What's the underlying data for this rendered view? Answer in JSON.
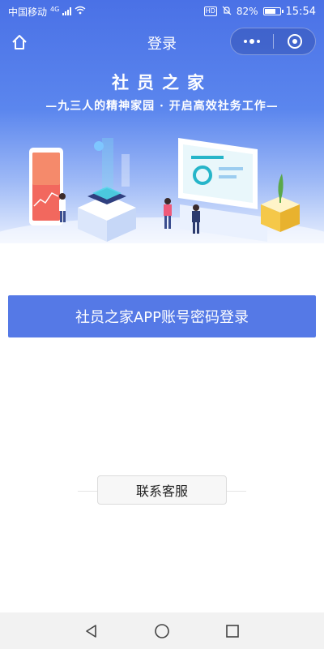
{
  "status_bar": {
    "carrier": "中国移动",
    "network": "4G",
    "hd": "HD",
    "battery": "82%",
    "battery_level": 0.82,
    "time": "15:54"
  },
  "nav": {
    "title": "登录"
  },
  "hero": {
    "title": "社员之家",
    "subtitle": "—九三人的精神家园 · 开启高效社务工作—"
  },
  "main": {
    "login_label": "社员之家APP账号密码登录",
    "support_label": "联系客服"
  },
  "colors": {
    "primary": "#5579e6",
    "hero_top": "#4a71e6"
  },
  "icons": {
    "home": "home-icon",
    "more": "more-dots-icon",
    "close": "capsule-close-icon",
    "back": "triangle-back-icon",
    "home_circle": "circle-home-icon",
    "recent": "square-recent-icon"
  }
}
